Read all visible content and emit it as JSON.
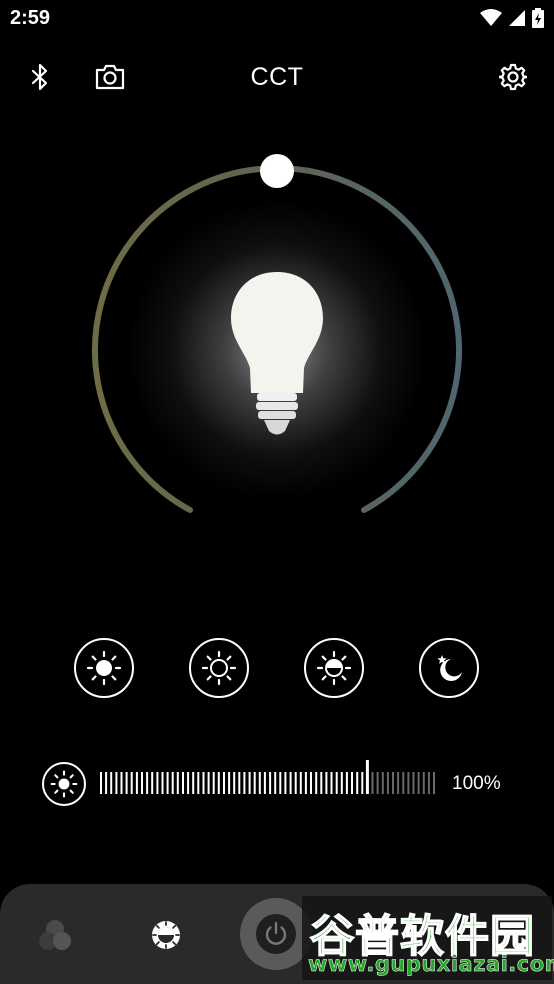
{
  "status_bar": {
    "time": "2:59"
  },
  "header": {
    "title": "CCT"
  },
  "dial": {
    "cct_position": 0.5
  },
  "presets": [
    {
      "name": "bright"
    },
    {
      "name": "soft"
    },
    {
      "name": "half"
    },
    {
      "name": "night"
    }
  ],
  "brightness": {
    "label": "100%",
    "level": 0.8
  },
  "bottom_nav": {
    "active": "cct"
  },
  "watermark": {
    "cn": "谷普软件园",
    "url": "www.gupuxiazai.com"
  },
  "colors": {
    "arc_warm": "#6b6a40",
    "arc_cool": "#4f6670",
    "background": "#000000",
    "nav_bg": "#2a2a2a"
  }
}
